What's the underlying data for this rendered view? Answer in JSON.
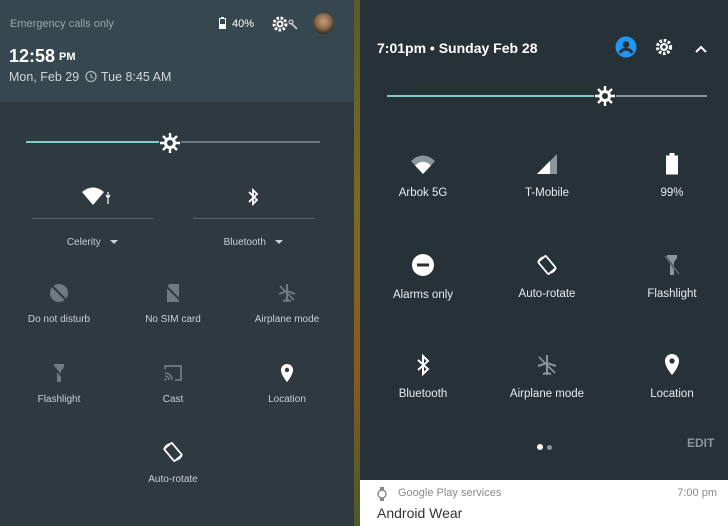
{
  "left": {
    "status_text": "Emergency calls only",
    "battery": "40%",
    "time": "12:58",
    "ampm": "PM",
    "date": "Mon, Feb 29",
    "alarm": "Tue 8:45 AM",
    "brightness_fraction": 0.49,
    "wifi_label": "Celerity",
    "bt_label": "Bluetooth",
    "tiles": [
      {
        "label": "Do not disturb",
        "icon": "do-not-disturb-icon"
      },
      {
        "label": "No SIM card",
        "icon": "no-sim-icon"
      },
      {
        "label": "Airplane mode",
        "icon": "airplane-icon"
      },
      {
        "label": "Flashlight",
        "icon": "flashlight-icon"
      },
      {
        "label": "Cast",
        "icon": "cast-icon"
      },
      {
        "label": "Location",
        "icon": "location-icon"
      },
      {
        "label": "Auto-rotate",
        "icon": "auto-rotate-icon"
      }
    ]
  },
  "right": {
    "header": "7:01pm • Sunday Feb 28",
    "brightness_fraction": 0.68,
    "tiles": [
      {
        "label": "Arbok 5G",
        "icon": "wifi-icon"
      },
      {
        "label": "T-Mobile",
        "icon": "signal-icon"
      },
      {
        "label": "99%",
        "icon": "battery-icon"
      },
      {
        "label": "Alarms only",
        "icon": "alarms-only-icon"
      },
      {
        "label": "Auto-rotate",
        "icon": "auto-rotate-icon"
      },
      {
        "label": "Flashlight",
        "icon": "flashlight-icon"
      },
      {
        "label": "Bluetooth",
        "icon": "bluetooth-icon"
      },
      {
        "label": "Airplane mode",
        "icon": "airplane-icon"
      },
      {
        "label": "Location",
        "icon": "location-icon"
      }
    ],
    "edit_label": "EDIT",
    "notification": {
      "app": "Google Play services",
      "time": "7:00 pm",
      "title": "Android Wear"
    }
  },
  "colors": {
    "accent": "#80cbc4",
    "blue": "#2196f3"
  }
}
